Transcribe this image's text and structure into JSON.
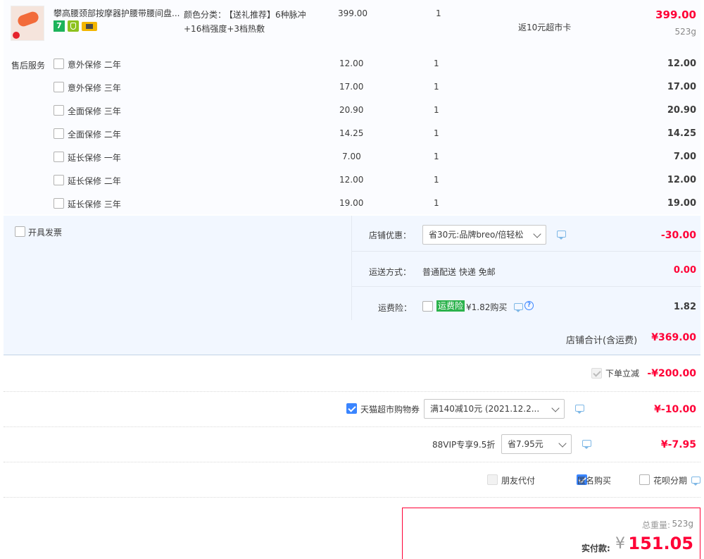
{
  "product": {
    "title": "攀高腰颈部按摩器护腰带腰间盘...",
    "sku_label": "颜色分类：",
    "sku_value_line1": "【送礼推荐】6种脉冲",
    "sku_value_line2": "+16档强度+3档热敷",
    "unit_price": "399.00",
    "quantity": "1",
    "promo": "返10元超市卡",
    "subtotal": "399.00",
    "weight": "523g",
    "badge_7": "7",
    "colors": {
      "thumb_bg": "#f26b3a",
      "badge_green": "#1db35b",
      "badge_yellow": "#f3b600"
    }
  },
  "after_sales": {
    "label": "售后服务",
    "items": [
      {
        "name": "意外保修 二年",
        "price": "12.00",
        "qty": "1",
        "total": "12.00"
      },
      {
        "name": "意外保修 三年",
        "price": "17.00",
        "qty": "1",
        "total": "17.00"
      },
      {
        "name": "全面保修 三年",
        "price": "20.90",
        "qty": "1",
        "total": "20.90"
      },
      {
        "name": "全面保修 二年",
        "price": "14.25",
        "qty": "1",
        "total": "14.25"
      },
      {
        "name": "延长保修 一年",
        "price": "7.00",
        "qty": "1",
        "total": "7.00"
      },
      {
        "name": "延长保修 二年",
        "price": "12.00",
        "qty": "1",
        "total": "12.00"
      },
      {
        "name": "延长保修 三年",
        "price": "19.00",
        "qty": "1",
        "total": "19.00"
      }
    ]
  },
  "invoice": {
    "label": "开具发票"
  },
  "shop": {
    "discount_label": "店铺优惠：",
    "discount_select": "省30元:品牌breo/倍轻松",
    "discount_amount": "-30.00",
    "shipping_label": "运送方式：",
    "shipping_value": "普通配送 快递 免邮",
    "shipping_amount": "0.00",
    "insurance_label": "运费险：",
    "insurance_tag": "运费险",
    "insurance_text": "¥1.82购买",
    "insurance_amount": "1.82",
    "total_label": "店铺合计(含运费)",
    "total_amount": "¥369.00"
  },
  "order_discounts": {
    "instant_label": "下单立减",
    "instant_amount": "-¥200.00",
    "coupon_label": "天猫超市购物券",
    "coupon_select": "满140减10元 (2021.12.2...",
    "coupon_amount": "¥-10.00",
    "vip_label": "88VIP专享9.5折",
    "vip_select": "省7.95元",
    "vip_amount": "¥-7.95"
  },
  "options": {
    "friend_pay": "朋友代付",
    "anonymous": "匿名购买",
    "huabei": "花呗分期"
  },
  "summary": {
    "weight_label": "总重量:",
    "weight_value": "523g",
    "pay_label": "实付款:",
    "currency": "¥",
    "pay_amount": "151.05"
  },
  "colors": {
    "accent_red": "#ff0036",
    "panel_blue": "#f2f7ff",
    "checkbox_blue": "#3a85ff"
  }
}
